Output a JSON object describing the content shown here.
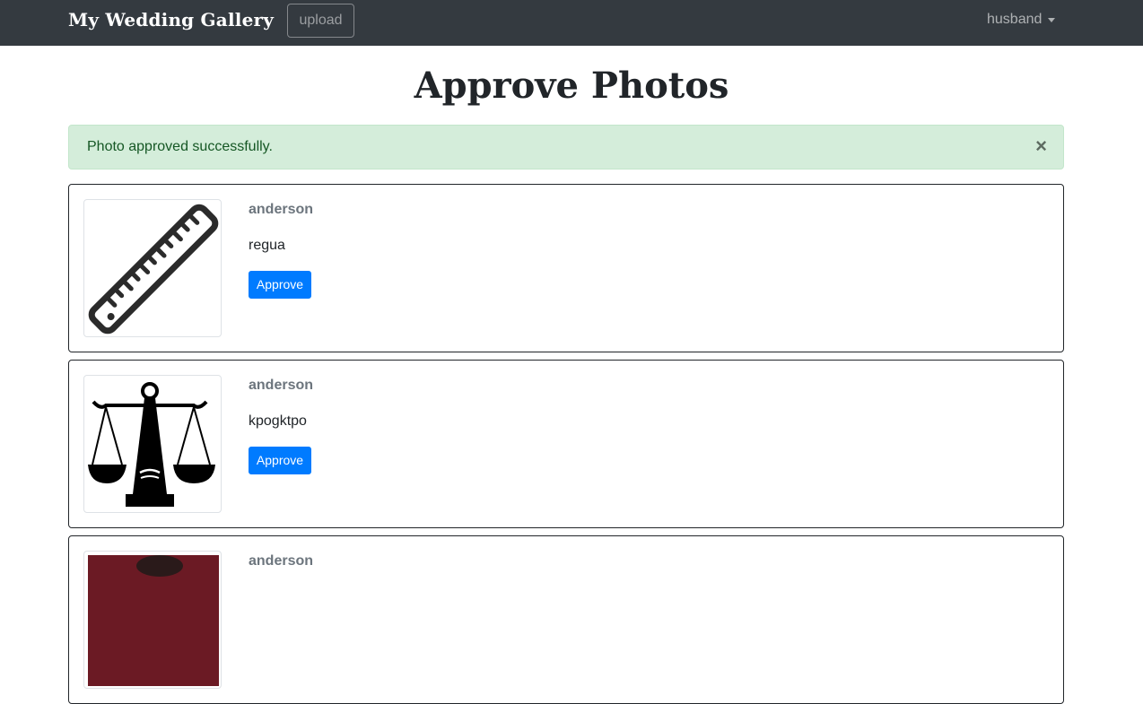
{
  "navbar": {
    "brand": "My Wedding Gallery",
    "upload_label": "upload",
    "user_label": "husband"
  },
  "page": {
    "title": "Approve Photos"
  },
  "alert": {
    "message": "Photo approved successfully.",
    "close_symbol": "×"
  },
  "photos": [
    {
      "author": "anderson",
      "caption": "regua",
      "approve_label": "Approve",
      "thumbnail_icon": "ruler-icon"
    },
    {
      "author": "anderson",
      "caption": "kpogktpo",
      "approve_label": "Approve",
      "thumbnail_icon": "scales-of-justice-icon"
    },
    {
      "author": "anderson",
      "thumbnail_icon": "portrait-photo"
    }
  ],
  "colors": {
    "navbar_bg": "#343a40",
    "alert_bg": "#d4edda",
    "alert_text": "#155724",
    "primary": "#007bff"
  }
}
